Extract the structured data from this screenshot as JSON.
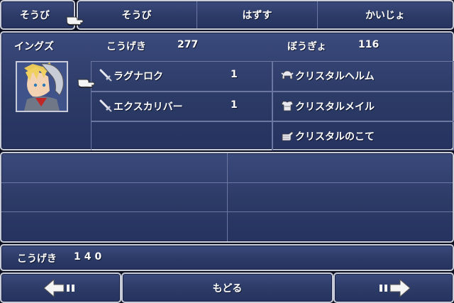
{
  "menu": {
    "left_label": "そうび",
    "tabs": [
      "そうび",
      "はずす",
      "かいじょ"
    ]
  },
  "character": {
    "name": "イングズ",
    "attack_label": "こうげき",
    "attack_value": "277",
    "defense_label": "ぼうぎょ",
    "defense_value": "116"
  },
  "weapons": [
    {
      "name": "ラグナロク",
      "count": "1",
      "icon": "sword-icon"
    },
    {
      "name": "エクスカリバー",
      "count": "1",
      "icon": "sword-icon"
    }
  ],
  "armor": [
    {
      "name": "クリスタルヘルム",
      "icon": "helmet-icon"
    },
    {
      "name": "クリスタルメイル",
      "icon": "armor-icon"
    },
    {
      "name": "クリスタルのこて",
      "icon": "gauntlet-icon"
    }
  ],
  "status": {
    "label": "こうげき",
    "value": "140"
  },
  "footer": {
    "back_label": "もどる",
    "prev_icon": "left-arrow-icon",
    "next_icon": "right-arrow-icon"
  },
  "colors": {
    "panel": "#2c3a66",
    "border": "#c8ccd8",
    "text": "#ffffff"
  }
}
